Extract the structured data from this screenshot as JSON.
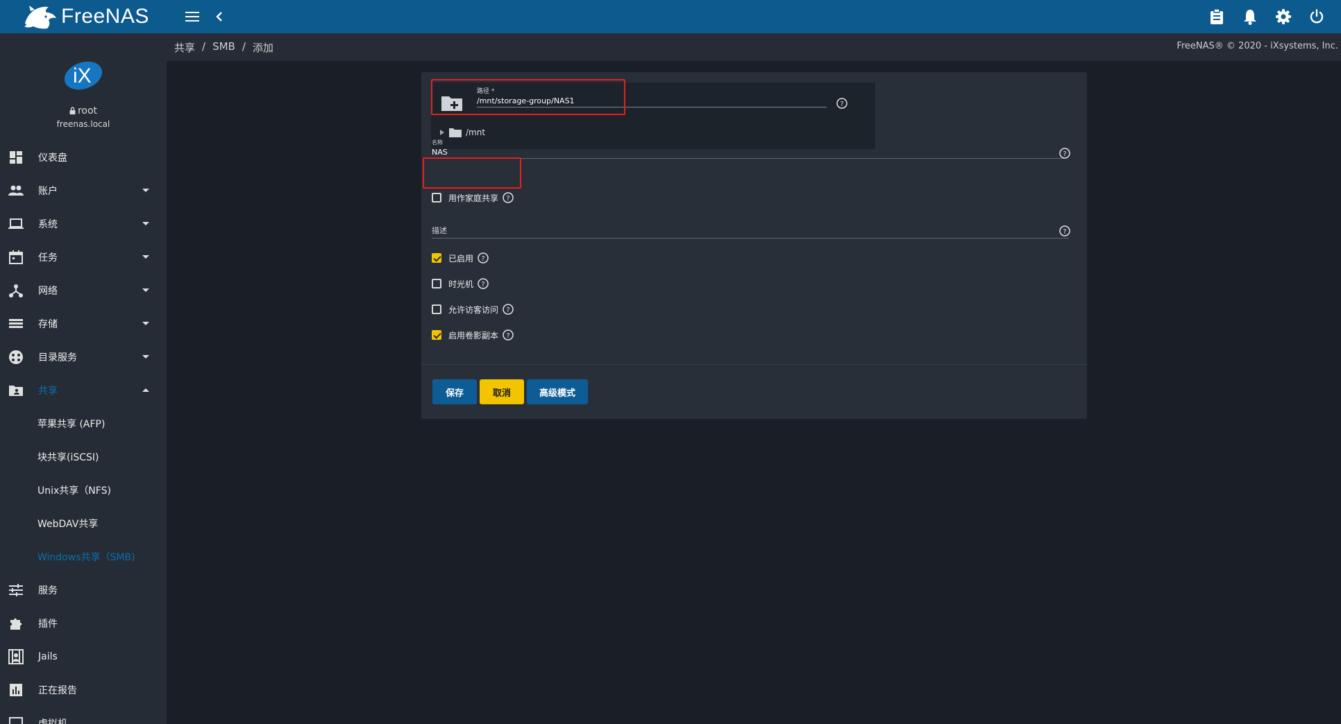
{
  "topbar": {
    "brand": "FreeNAS",
    "icons": [
      "menu-icon",
      "chevron-left-icon",
      "clipboard-icon",
      "bell-icon",
      "gear-icon",
      "power-icon"
    ]
  },
  "profile": {
    "logo": "iX",
    "user": "root",
    "host": "freenas.local"
  },
  "sidebar": {
    "items": [
      {
        "label": "仪表盘",
        "icon": "dashboard-icon",
        "caret": "none"
      },
      {
        "label": "账户",
        "icon": "people-icon",
        "caret": "down"
      },
      {
        "label": "系统",
        "icon": "laptop-icon",
        "caret": "down"
      },
      {
        "label": "任务",
        "icon": "calendar-icon",
        "caret": "down"
      },
      {
        "label": "网络",
        "icon": "network-icon",
        "caret": "down"
      },
      {
        "label": "存储",
        "icon": "storage-icon",
        "caret": "down"
      },
      {
        "label": "目录服务",
        "icon": "directory-icon",
        "caret": "down"
      },
      {
        "label": "共享",
        "icon": "share-icon",
        "caret": "up",
        "active": true
      }
    ],
    "sub_items": [
      {
        "label": "苹果共享 (AFP)"
      },
      {
        "label": "块共享(iSCSI)"
      },
      {
        "label": "Unix共享（NFS)"
      },
      {
        "label": "WebDAV共享"
      },
      {
        "label": "Windows共享（SMB)",
        "active": true
      }
    ],
    "items_after": [
      {
        "label": "服务",
        "icon": "sliders-icon"
      },
      {
        "label": "插件",
        "icon": "puzzle-icon"
      },
      {
        "label": "Jails",
        "icon": "jail-icon"
      },
      {
        "label": "正在报告",
        "icon": "chart-icon"
      },
      {
        "label": "虚拟机",
        "icon": "monitor-icon"
      }
    ]
  },
  "breadcrumb": {
    "items": [
      "共享",
      "SMB",
      "添加"
    ],
    "separator": "/",
    "copyright": "FreeNAS® © 2020 - iXsystems, Inc."
  },
  "form": {
    "path_label": "路径 *",
    "path_value": "/mnt/storage-group/NAS1",
    "tree_root": "/mnt",
    "name_label": "名称",
    "name_value": "NAS",
    "home_share_label": "用作家庭共享",
    "home_share_checked": false,
    "description_label": "描述",
    "description_value": "",
    "enabled_label": "已启用",
    "enabled_checked": true,
    "timemachine_label": "时光机",
    "timemachine_checked": false,
    "guest_label": "允许访客访问",
    "guest_checked": false,
    "shadow_label": "启用卷影副本",
    "shadow_checked": true
  },
  "buttons": {
    "save": "保存",
    "cancel": "取消",
    "advanced": "高级模式"
  },
  "colors": {
    "topbar": "#0d5a8f",
    "sidebar": "#262c35",
    "background": "#1a1f27",
    "card": "#282f39",
    "accent_yellow": "#f2c500",
    "button_blue": "#0e5c95",
    "active_link": "#0a6fb0",
    "annotation_red": "#e52020"
  }
}
